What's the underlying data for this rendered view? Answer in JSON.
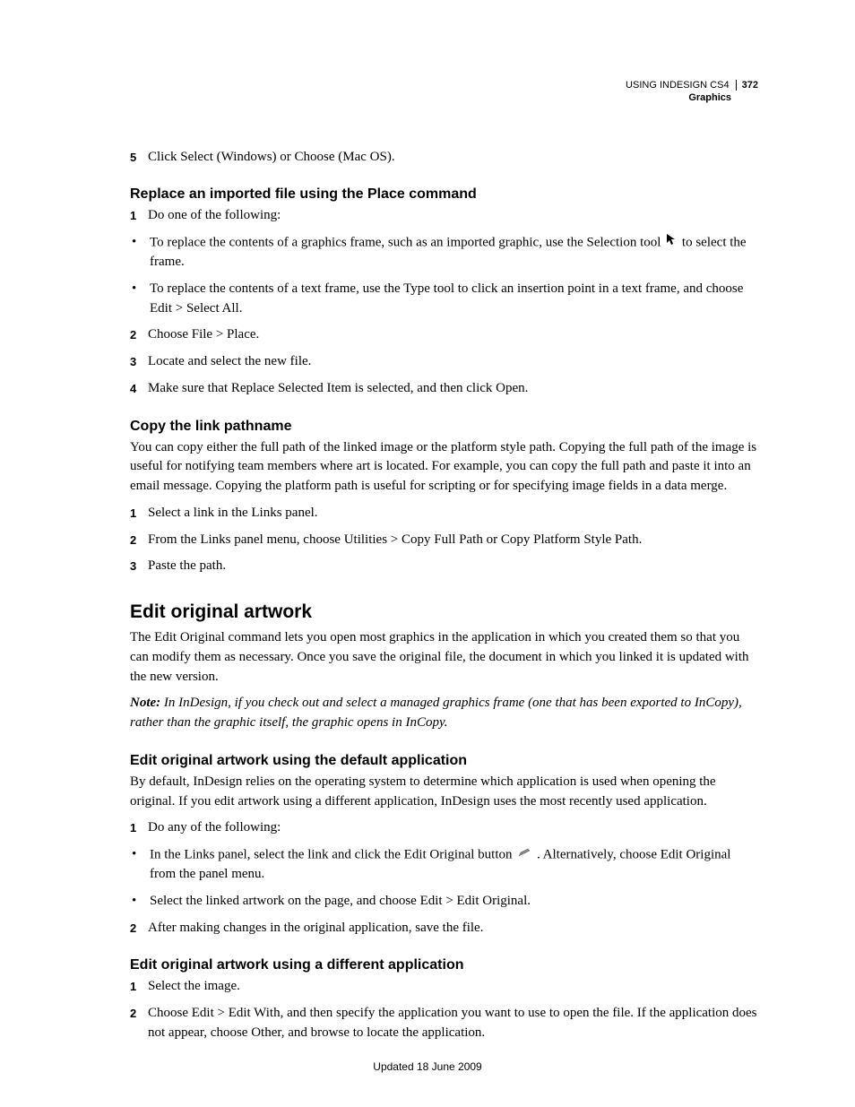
{
  "header": {
    "product": "USING INDESIGN CS4",
    "section": "Graphics",
    "page_number": "372"
  },
  "step5_leadin_num": "5",
  "step5_leadin_text": "Click Select (Windows) or Choose (Mac OS).",
  "replace_heading": "Replace an imported file using the Place command",
  "replace_steps": {
    "s1_num": "1",
    "s1_text": "Do one of the following:",
    "b1_a": "To replace the contents of a graphics frame, such as an imported graphic, use the Selection tool ",
    "b1_b": " to select the frame.",
    "b2": "To replace the contents of a text frame, use the Type tool to click an insertion point in a text frame, and choose Edit > Select All.",
    "s2_num": "2",
    "s2_text": "Choose File > Place.",
    "s3_num": "3",
    "s3_text": "Locate and select the new file.",
    "s4_num": "4",
    "s4_text": "Make sure that Replace Selected Item is selected, and then click Open."
  },
  "copy_heading": "Copy the link pathname",
  "copy_intro": "You can copy either the full path of the linked image or the platform style path. Copying the full path of the image is useful for notifying team members where art is located. For example, you can copy the full path and paste it into an email message. Copying the platform path is useful for scripting or for specifying image fields in a data merge.",
  "copy_steps": {
    "s1_num": "1",
    "s1_text": "Select a link in the Links panel.",
    "s2_num": "2",
    "s2_text": "From the Links panel menu, choose Utilities > Copy Full Path or Copy Platform Style Path.",
    "s3_num": "3",
    "s3_text": "Paste the path."
  },
  "edit_section_heading": "Edit original artwork",
  "edit_intro": "The Edit Original command lets you open most graphics in the application in which you created them so that you can modify them as necessary. Once you save the original file, the document in which you linked it is updated with the new version.",
  "edit_note_label": "Note:",
  "edit_note_text": " In InDesign, if you check out and select a managed graphics frame (one that has been exported to InCopy), rather than the graphic itself, the graphic opens in InCopy.",
  "edit_default_heading": "Edit original artwork using the default application",
  "edit_default_intro": "By default, InDesign relies on the operating system to determine which application is used when opening the original. If you edit artwork using a different application, InDesign uses the most recently used application.",
  "edit_default_steps": {
    "s1_num": "1",
    "s1_text": "Do any of the following:",
    "b1_a": "In the Links panel, select the link and click the Edit Original button ",
    "b1_b": " . Alternatively, choose Edit Original from the panel menu.",
    "b2": "Select the linked artwork on the page, and choose Edit > Edit Original.",
    "s2_num": "2",
    "s2_text": "After making changes in the original application, save the file."
  },
  "edit_diff_heading": "Edit original artwork using a different application",
  "edit_diff_steps": {
    "s1_num": "1",
    "s1_text": "Select the image.",
    "s2_num": "2",
    "s2_text": "Choose Edit > Edit With, and then specify the application you want to use to open the file. If the application does not appear, choose Other, and browse to locate the application."
  },
  "footer_text": "Updated 18 June 2009"
}
